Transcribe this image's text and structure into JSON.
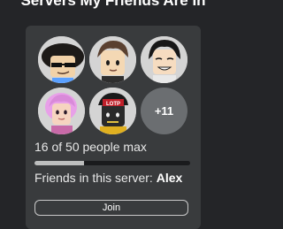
{
  "header": {
    "title": "Servers My Friends Are In"
  },
  "server_card": {
    "avatars": [
      {
        "icon": "avatar-black-hair-sunglasses"
      },
      {
        "icon": "avatar-brown-hair"
      },
      {
        "icon": "avatar-black-hair-smile"
      },
      {
        "icon": "avatar-pink-hair"
      },
      {
        "icon": "avatar-red-sign-hat"
      }
    ],
    "more_friends_label": "+11",
    "player_count_text": "16 of 50 people max",
    "capacity_fill": 0.32,
    "friends_prefix": "Friends in this server:",
    "friend_name": "Alex",
    "join_label": "Join"
  },
  "colors": {
    "background": "#242528",
    "card": "#393b3d",
    "bar_track": "#1a1b1d",
    "bar_fill": "#bdbebe"
  }
}
